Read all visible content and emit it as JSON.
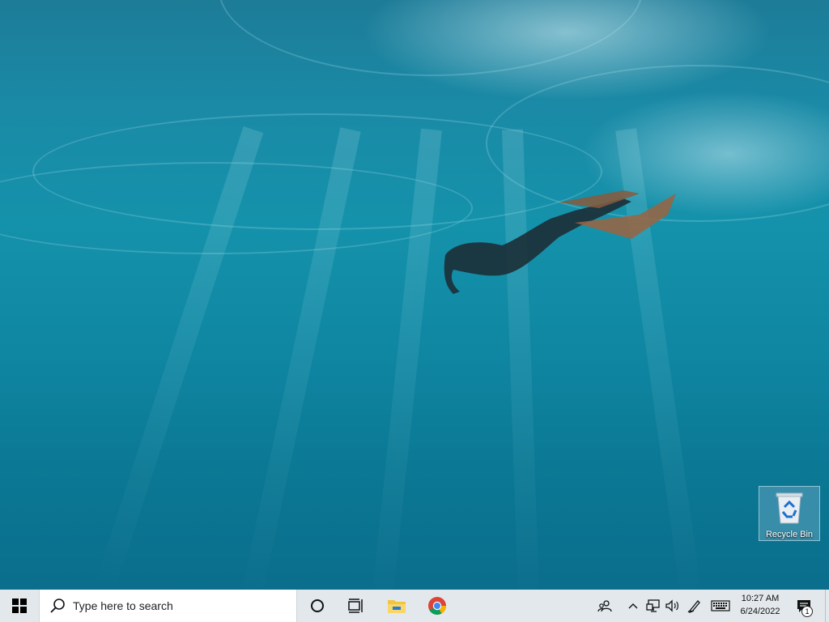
{
  "desktop": {
    "wallpaper": "underwater-freediver",
    "icons": [
      {
        "label": "Recycle Bin",
        "icon": "recycle-bin-icon"
      }
    ]
  },
  "taskbar": {
    "start_icon": "windows-logo-icon",
    "search": {
      "placeholder": "Type here to search",
      "icon": "search-icon"
    },
    "cortana_icon": "cortana-circle-icon",
    "task_view_icon": "task-view-icon",
    "pinned_apps": [
      {
        "icon": "file-explorer-icon"
      },
      {
        "icon": "chrome-icon"
      }
    ],
    "tray": {
      "icons": [
        "people-icon",
        "show-hidden-icons-chevron",
        "network-icon",
        "volume-icon",
        "pen-icon",
        "keyboard-icon"
      ],
      "time": "10:27 AM",
      "date": "6/24/2022",
      "notification_count": "1"
    }
  },
  "colors": {
    "taskbar_bg": "#e3e8ec",
    "water": "#1592ab",
    "chrome_red": "#db4437",
    "chrome_green": "#0f9d58",
    "chrome_yellow": "#f4b400",
    "chrome_blue": "#4285f4",
    "folder_yellow": "#f2c53d"
  }
}
